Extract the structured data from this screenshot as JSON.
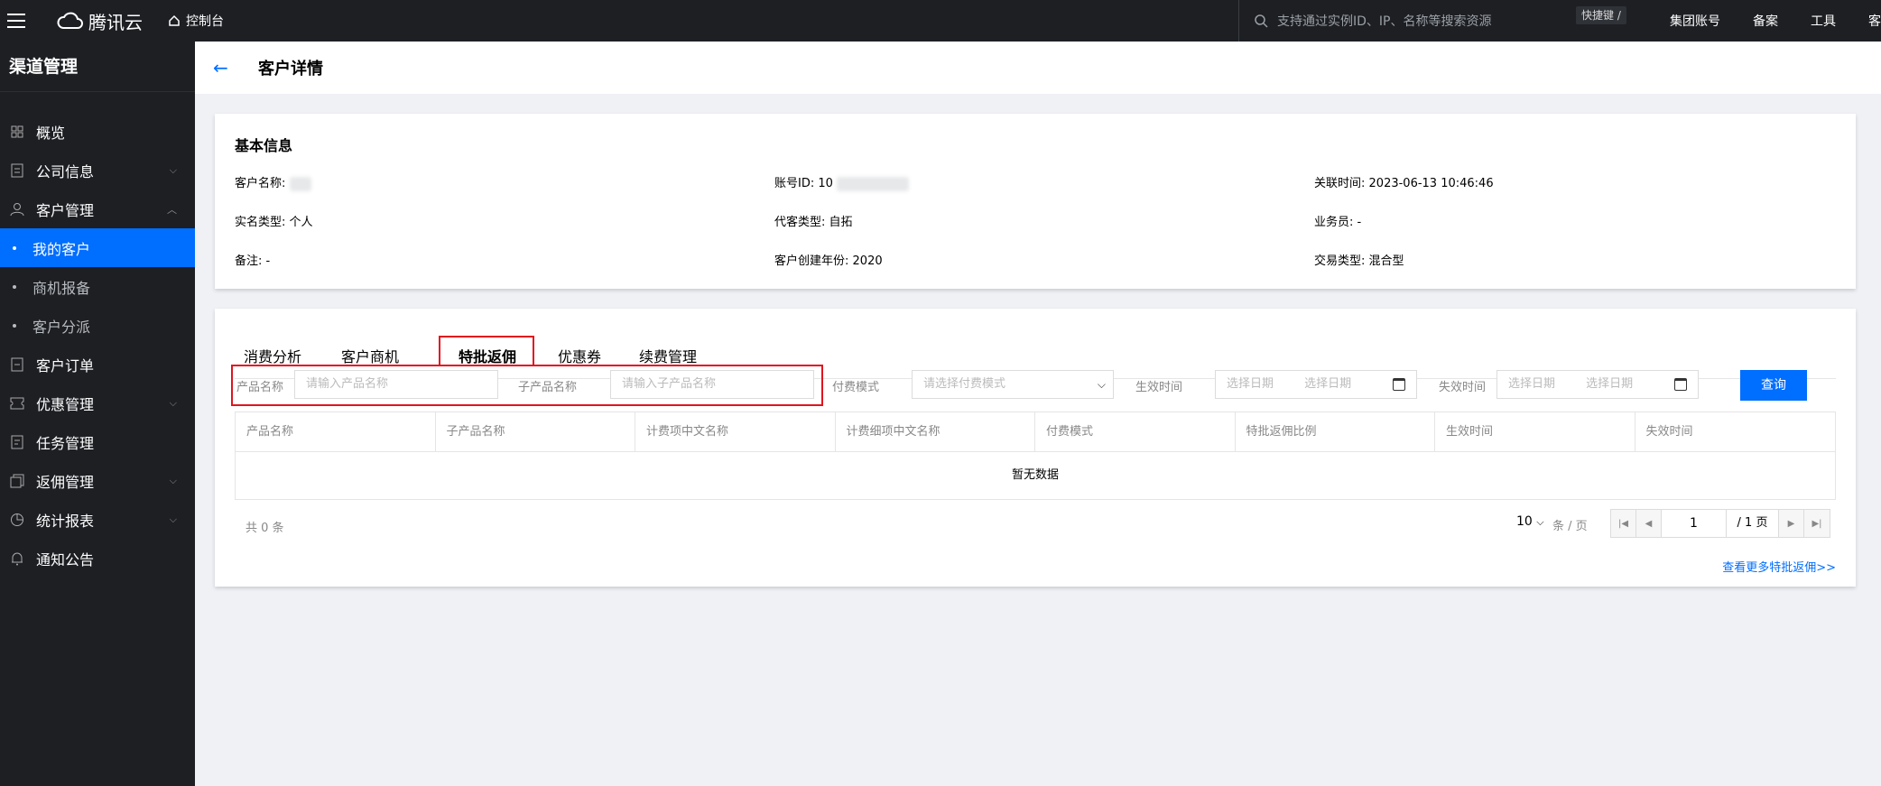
{
  "topbar": {
    "brand": "腾讯云",
    "console_label": "控制台",
    "search_placeholder": "支持通过实例ID、IP、名称等搜索资源",
    "shortcut": "快捷键 /",
    "links": [
      "集团账号",
      "备案",
      "工具",
      "客"
    ]
  },
  "sidebar": {
    "title": "渠道管理",
    "items": [
      {
        "label": "概览",
        "icon": "grid-icon"
      },
      {
        "label": "公司信息",
        "icon": "document-icon"
      },
      {
        "label": "客户管理",
        "icon": "user-icon"
      },
      {
        "label": "我的客户"
      },
      {
        "label": "商机报备"
      },
      {
        "label": "客户分派"
      },
      {
        "label": "客户订单",
        "icon": "order-icon"
      },
      {
        "label": "优惠管理",
        "icon": "ticket-icon"
      },
      {
        "label": "任务管理",
        "icon": "task-icon"
      },
      {
        "label": "返佣管理",
        "icon": "rebate-icon"
      },
      {
        "label": "统计报表",
        "icon": "pie-chart-icon"
      },
      {
        "label": "通知公告",
        "icon": "bell-icon"
      }
    ]
  },
  "header": {
    "title": "客户详情"
  },
  "basic_info": {
    "title": "基本信息",
    "customer_name_label": "客户名称:",
    "account_id_label": "账号ID:",
    "account_id_prefix": "10",
    "link_time_label": "关联时间:",
    "link_time": "2023-06-13 10:46:46",
    "real_name_type_label": "实名类型:",
    "real_name_type": "个人",
    "agent_type_label": "代客类型:",
    "agent_type": "自拓",
    "salesperson_label": "业务员:",
    "salesperson": "-",
    "note_label": "备注:",
    "note": "-",
    "create_year_label": "客户创建年份:",
    "create_year": "2020",
    "trade_type_label": "交易类型:",
    "trade_type": "混合型"
  },
  "tabs": [
    "消费分析",
    "客户商机",
    "特批返佣",
    "优惠券",
    "续费管理"
  ],
  "filters": {
    "product_name_label": "产品名称",
    "product_name_placeholder": "请输入产品名称",
    "sub_product_label": "子产品名称",
    "sub_product_placeholder": "请输入子产品名称",
    "pay_mode_label": "付费模式",
    "pay_mode_placeholder": "请选择付费模式",
    "effective_label": "生效时间",
    "expire_label": "失效时间",
    "date_placeholder": "选择日期",
    "query_button": "查询"
  },
  "table": {
    "headers": [
      "产品名称",
      "子产品名称",
      "计费项中文名称",
      "计费细项中文名称",
      "付费模式",
      "特批返佣比例",
      "生效时间",
      "失效时间"
    ],
    "empty_text": "暂无数据"
  },
  "pagination": {
    "total_text": "共 0 条",
    "page_size": "10",
    "page_unit": "条 / 页",
    "current_page": "1",
    "total_pages": "/ 1 页"
  },
  "more_link": "查看更多特批返佣>>"
}
